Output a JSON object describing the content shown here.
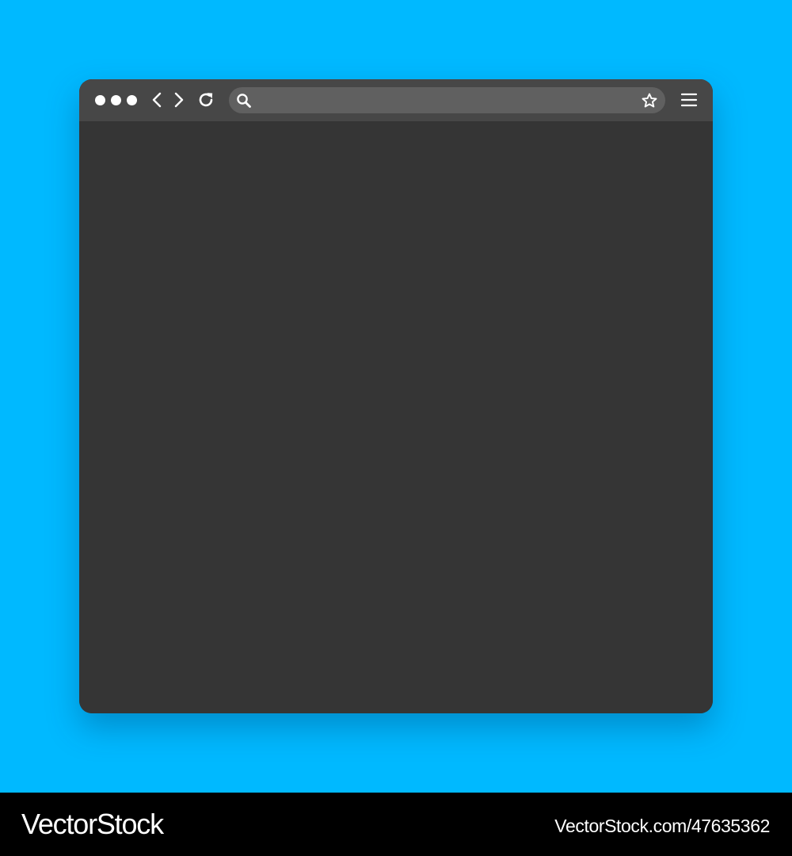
{
  "colors": {
    "background": "#00b9ff",
    "window": "#353535",
    "toolbar": "#474747",
    "address_bar": "#606060",
    "icon": "#ffffff",
    "footer": "#000000"
  },
  "toolbar": {
    "window_controls": [
      "dot",
      "dot",
      "dot"
    ],
    "icons": {
      "back": "chevron-left-icon",
      "forward": "chevron-right-icon",
      "reload": "reload-icon",
      "search": "search-icon",
      "bookmark": "star-icon",
      "menu": "hamburger-menu-icon"
    },
    "address_value": "",
    "address_placeholder": ""
  },
  "footer": {
    "brand": "VectorStock",
    "url": "VectorStock.com/47635362"
  }
}
